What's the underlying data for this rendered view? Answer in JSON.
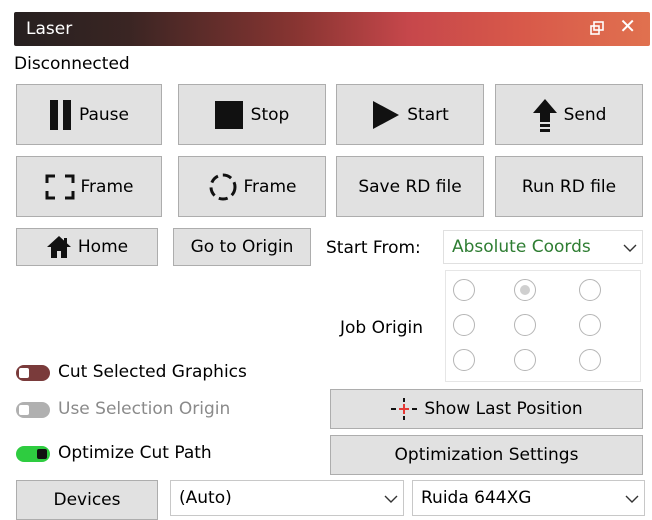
{
  "window": {
    "title": "Laser",
    "float_icon": "float-window-icon",
    "close_icon": "close-icon"
  },
  "status": "Disconnected",
  "row1": {
    "pause": {
      "label": "Pause",
      "icon": "pause-icon"
    },
    "stop": {
      "label": "Stop",
      "icon": "stop-icon"
    },
    "start": {
      "label": "Start",
      "icon": "play-icon"
    },
    "send": {
      "label": "Send",
      "icon": "send-arrow-icon"
    }
  },
  "row2": {
    "frame_rect": {
      "label": "Frame",
      "icon": "rect-frame-icon"
    },
    "frame_circle": {
      "label": "Frame",
      "icon": "circle-frame-icon"
    },
    "save_rd": {
      "label": "Save RD file"
    },
    "run_rd": {
      "label": "Run RD file"
    }
  },
  "row3": {
    "home": {
      "label": "Home",
      "icon": "home-icon"
    },
    "go_origin": {
      "label": "Go to Origin"
    },
    "start_from_label": "Start From:",
    "start_from_value": "Absolute Coords"
  },
  "job_origin": {
    "label": "Job Origin",
    "selected_index": 1
  },
  "options": {
    "cut_selected": {
      "label": "Cut Selected Graphics",
      "state": "off",
      "color": "#7a3b3b"
    },
    "use_selection_origin": {
      "label": "Use Selection Origin",
      "state": "disabled",
      "color": "#b0b0b0"
    },
    "optimize": {
      "label": "Optimize Cut Path",
      "state": "on",
      "color": "#2ecc40"
    }
  },
  "right_buttons": {
    "show_last": {
      "label": "Show Last Position",
      "icon": "crosshair-icon"
    },
    "opt_settings": {
      "label": "Optimization Settings"
    }
  },
  "bottom": {
    "devices": {
      "label": "Devices"
    },
    "port_select": "(Auto)",
    "device_select": "Ruida 644XG"
  },
  "colors": {
    "accent_green": "#2e7d32"
  }
}
